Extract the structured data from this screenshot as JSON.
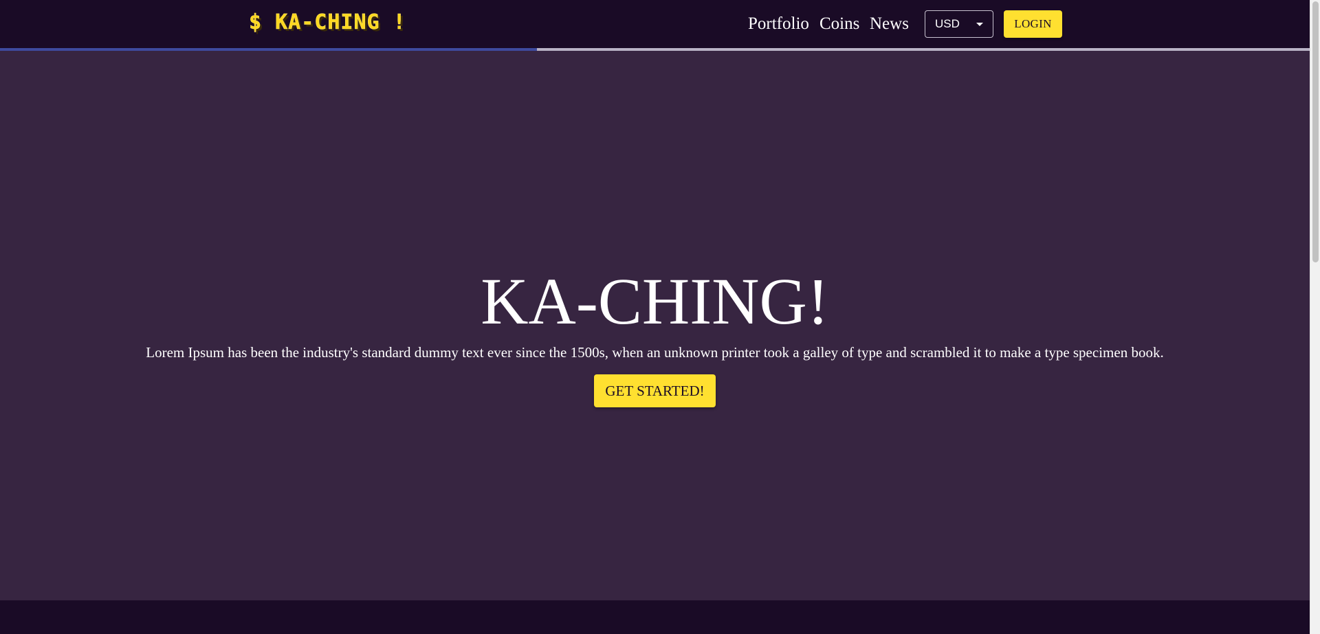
{
  "header": {
    "logo_text": "$ KA-CHING !",
    "nav": {
      "portfolio": "Portfolio",
      "coins": "Coins",
      "news": "News"
    },
    "currency": {
      "selected": "USD"
    },
    "login_label": "LOGIN",
    "progress": 0.41
  },
  "hero": {
    "title": "KA-CHING!",
    "text": "Lorem Ipsum has been the industry's standard dummy text ever since the 1500s, when an unknown printer took a galley of type and scrambled it to make a type specimen book.",
    "cta_label": "GET STARTED!"
  },
  "colors": {
    "navbar_bg": "#1a0b26",
    "hero_bg": "#372541",
    "accent_yellow": "#ffe030",
    "progress_fill": "#3e4a9e",
    "progress_track": "#b9b3c6"
  },
  "icons": {
    "caret": "caret-down-icon",
    "logo": "dollar-logo-icon"
  }
}
